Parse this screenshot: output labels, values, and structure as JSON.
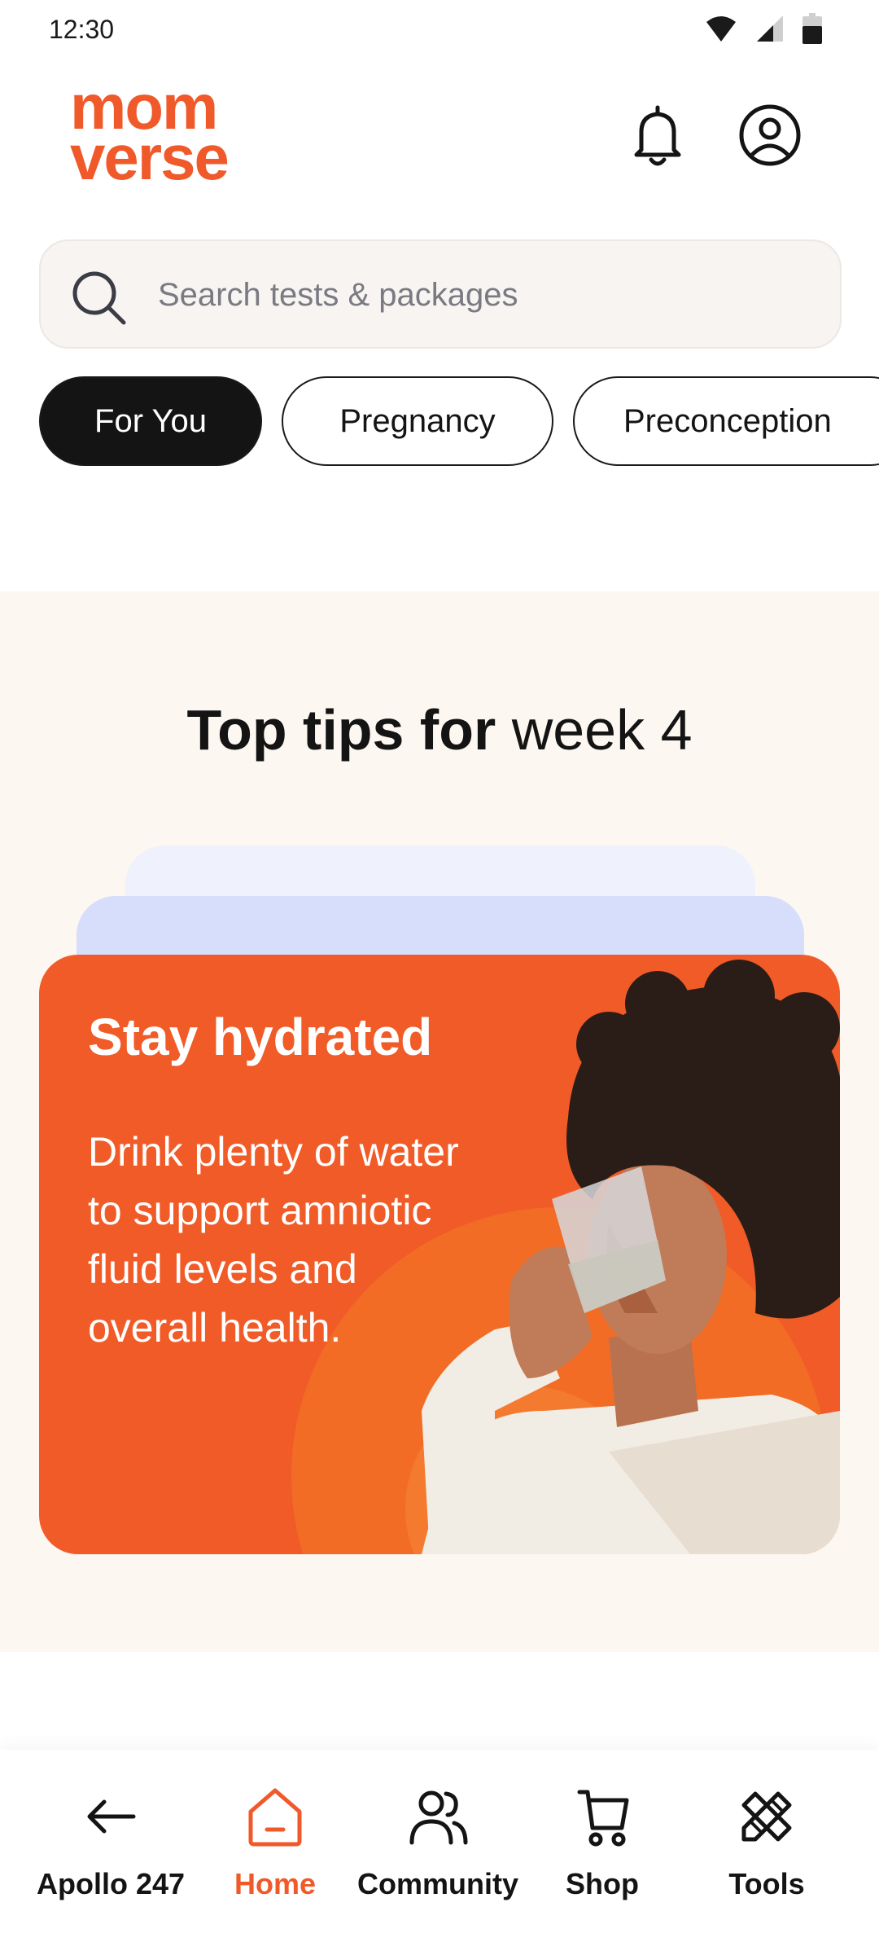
{
  "status_bar": {
    "time": "12:30",
    "icons": [
      "wifi-icon",
      "signal-icon",
      "battery-icon"
    ]
  },
  "header": {
    "logo_line1": "mom",
    "logo_line2": "verse",
    "icons": [
      "bell-icon",
      "profile-icon"
    ]
  },
  "search": {
    "placeholder": "Search tests & packages",
    "icon": "search-icon"
  },
  "chips": [
    {
      "label": "For You",
      "active": true
    },
    {
      "label": "Pregnancy",
      "active": false
    },
    {
      "label": "Preconception",
      "active": false
    }
  ],
  "tips": {
    "title_bold": "Top tips for",
    "title_regular": "week 4",
    "card": {
      "title": "Stay hydrated",
      "body": "Drink plenty of water to support amniotic fluid levels and overall health."
    }
  },
  "bottom_nav": [
    {
      "label": "Apollo 247",
      "icon": "back-arrow-icon",
      "active": false
    },
    {
      "label": "Home",
      "icon": "home-icon",
      "active": true
    },
    {
      "label": "Community",
      "icon": "community-icon",
      "active": false
    },
    {
      "label": "Shop",
      "icon": "cart-icon",
      "active": false
    },
    {
      "label": "Tools",
      "icon": "tools-icon",
      "active": false
    }
  ],
  "colors": {
    "brand": "#f0592a",
    "card": "#f15b27",
    "section_bg": "#fcf7f1",
    "chip_active": "#141414"
  }
}
